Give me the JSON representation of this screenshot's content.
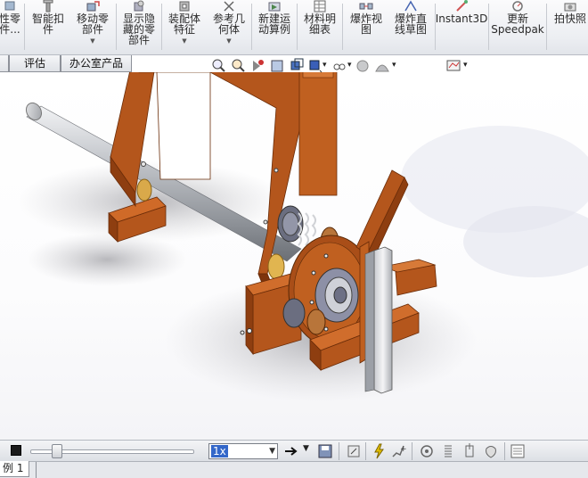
{
  "ribbon": {
    "buttons": [
      {
        "id": "smart-fastener",
        "label": "智能扣\n件"
      },
      {
        "id": "move-component",
        "label": "移动零\n部件"
      },
      {
        "id": "show-hidden",
        "label": "显示隐\n藏的零\n部件"
      },
      {
        "id": "assembly-features",
        "label": "装配体\n特征"
      },
      {
        "id": "reference-geometry",
        "label": "参考几\n何体"
      },
      {
        "id": "new-motion-study",
        "label": "新建运\n动算例"
      },
      {
        "id": "bom",
        "label": "材料明\n细表"
      },
      {
        "id": "exploded-view",
        "label": "爆炸视\n图"
      },
      {
        "id": "explode-line-sketch",
        "label": "爆炸直\n线草图"
      },
      {
        "id": "instant3d",
        "label": "Instant3D"
      },
      {
        "id": "update-speedpak",
        "label": "更新\nSpeedpak"
      },
      {
        "id": "snapshot",
        "label": "拍快照"
      }
    ],
    "partial_left_label": "性零\n件..."
  },
  "tabs": [
    {
      "id": "evaluate",
      "label": "评估"
    },
    {
      "id": "office-products",
      "label": "办公室产品"
    }
  ],
  "motion_bar": {
    "playback_speed": "1x"
  },
  "bottom_tabs": {
    "study_label": "例 1"
  },
  "colors": {
    "frame_orange": "#b4561c",
    "shaft_gray": "#9ea2a8",
    "ribbon_bg": "#eceef2",
    "selection_blue": "#3367c9"
  },
  "icons": [
    "zoom-to-fit-icon",
    "zoom-area-icon",
    "previous-view-icon",
    "section-view-icon",
    "view-orientation-icon",
    "display-style-icon",
    "hide-show-items-icon",
    "edit-appearance-icon",
    "apply-scene-icon",
    "view-settings-icon",
    "stop-icon",
    "arrow-right-icon",
    "save-animation-icon",
    "calculate-icon",
    "motor-icon",
    "spring-icon",
    "contact-icon",
    "gravity-icon",
    "results-icon"
  ]
}
